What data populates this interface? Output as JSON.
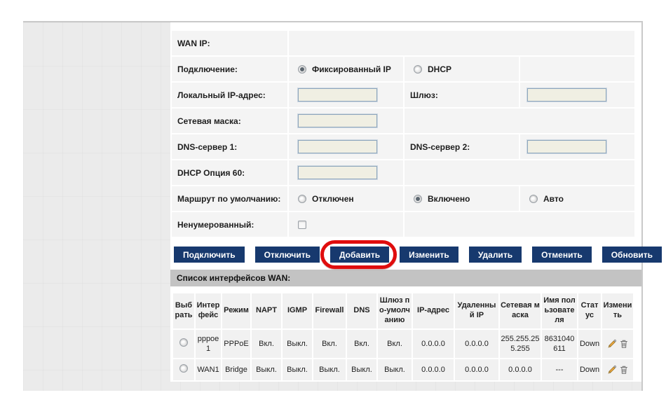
{
  "section": {
    "title": "Список интерфейсов WAN:"
  },
  "form": {
    "rows": [
      {
        "label": "WAN IP:"
      },
      {
        "label": "Подключение:",
        "options": [
          {
            "label": "Фиксированный IP",
            "selected": true
          },
          {
            "label": "DHCP",
            "selected": false
          }
        ]
      },
      {
        "label": "Локальный IP-адрес:",
        "label2": "Шлюз:"
      },
      {
        "label": "Сетевая маска:"
      },
      {
        "label": "DNS-сервер 1:",
        "label2": "DNS-сервер 2:"
      },
      {
        "label": "DHCP Опция 60:"
      },
      {
        "label": "Маршрут по умолчанию:",
        "options": [
          {
            "label": "Отключен",
            "selected": false
          },
          {
            "label": "Включено",
            "selected": true
          },
          {
            "label": "Авто",
            "selected": false
          }
        ]
      },
      {
        "label": "Ненумерованный:",
        "checkbox_checked": false
      }
    ],
    "values": {
      "local_ip": "",
      "gateway": "",
      "netmask": "",
      "dns1": "",
      "dns2": "",
      "dhcp_option60": ""
    }
  },
  "toolbar": {
    "buttons": [
      "Подключить",
      "Отключить",
      "Добавить",
      "Изменить",
      "Удалить",
      "Отменить",
      "Обновить"
    ],
    "highlighted_button": "Добавить"
  },
  "table": {
    "headers": [
      "Выбрать",
      "Интерфейс",
      "Режим",
      "NAPT",
      "IGMP",
      "Firewall",
      "DNS",
      "Шлюз по-умолчанию",
      "IP-адрес",
      "Удаленный IP",
      "Сетевая маска",
      "Имя пользователя",
      "Статус",
      "Изменить"
    ],
    "rows": [
      {
        "interface": "pppoe1",
        "mode": "PPPoE",
        "napt": "Вкл.",
        "igmp": "Выкл.",
        "firewall": "Вкл.",
        "dns": "Вкл.",
        "gateway": "Вкл.",
        "ip": "0.0.0.0",
        "remote_ip": "0.0.0.0",
        "netmask": "255.255.255.255",
        "username": "8631040611",
        "status": "Down"
      },
      {
        "interface": "WAN1",
        "mode": "Bridge",
        "napt": "Выкл.",
        "igmp": "Выкл.",
        "firewall": "Выкл.",
        "dns": "Выкл.",
        "gateway": "Выкл.",
        "ip": "0.0.0.0",
        "remote_ip": "0.0.0.0",
        "netmask": "0.0.0.0",
        "username": "---",
        "status": "Down"
      }
    ]
  },
  "colors": {
    "button_bg": "#17396e",
    "highlight_red": "#e00d0d",
    "section_bar_bg": "#c3c3c3",
    "page_bg": "#ebebeb",
    "row_bg": "#f4f4f4",
    "input_bg": "#f0efe3"
  }
}
